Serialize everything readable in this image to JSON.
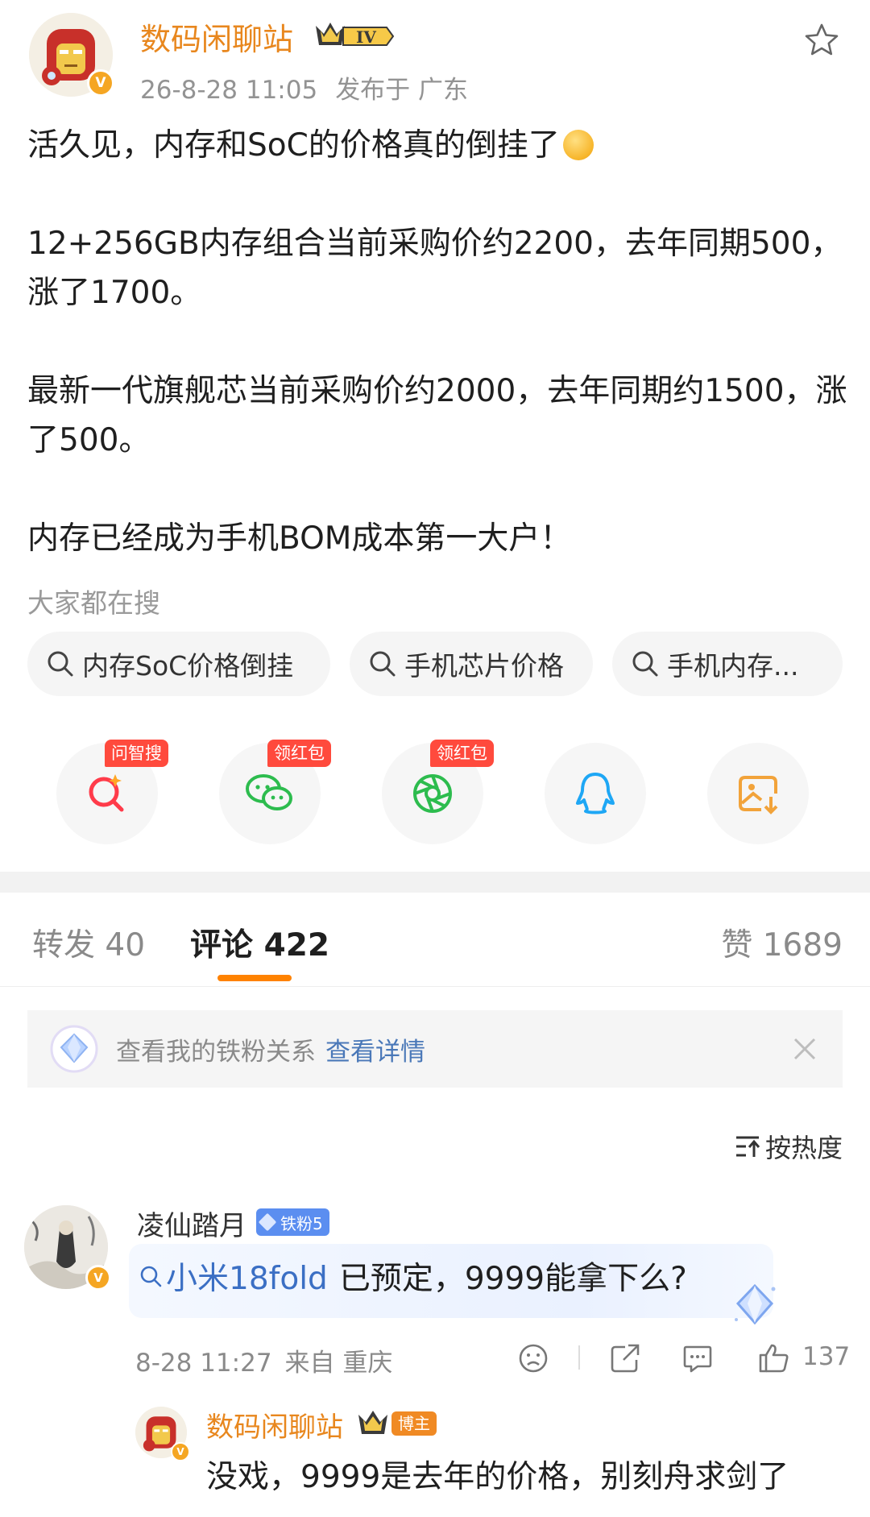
{
  "post": {
    "author": "数码闲聊站",
    "level_badge": "IV",
    "time": "26-8-28 11:05",
    "location": "发布于 广东",
    "paragraphs": [
      "活久见，内存和SoC的价格真的倒挂了",
      "12+256GB内存组合当前采购价约2200，去年同期500，涨了1700。",
      "最新一代旗舰芯当前采购价约2000，去年同期约1500，涨了500。",
      "内存已经成为手机BOM成本第一大户！"
    ]
  },
  "hot_search": {
    "title": "大家都在搜",
    "chips": [
      "内存SoC价格倒挂",
      "手机芯片价格",
      "手机内存..."
    ]
  },
  "share": {
    "tags": [
      "问智搜",
      "领红包",
      "领红包"
    ],
    "icons": [
      "ai-search-icon",
      "wechat-icon",
      "moments-icon",
      "qq-icon",
      "save-image-icon"
    ]
  },
  "tabs": [
    {
      "label": "转发",
      "count": "40"
    },
    {
      "label": "评论",
      "count": "422"
    },
    {
      "label": "赞",
      "count": "1689"
    }
  ],
  "fan_banner": {
    "text": "查看我的铁粉关系",
    "link": "查看详情"
  },
  "sort": {
    "label": "按热度"
  },
  "comment": {
    "user": "凌仙踏月",
    "fan_badge": "铁粉5",
    "topic": "小米18fold",
    "text": "已预定，9999能拿下么?",
    "time": "8-28 11:27",
    "location": "来自 重庆",
    "likes": "137"
  },
  "reply": {
    "user": "数码闲聊站",
    "tag": "博主",
    "text": "没戏，9999是去年的价格，别刻舟求剑了"
  },
  "colors": {
    "accent": "#ff8200",
    "author_name": "#e8871e",
    "link_blue": "#4a78b8",
    "tag_red": "#ff4a3d"
  }
}
